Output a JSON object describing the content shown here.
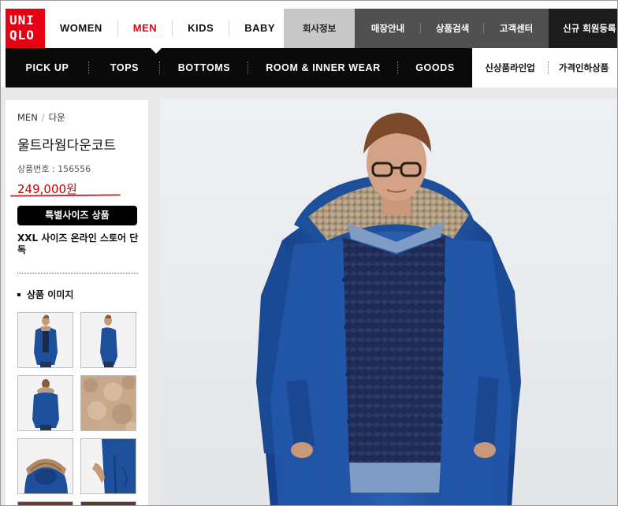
{
  "brand": {
    "logo_line1": "UNI",
    "logo_line2": "QLO",
    "red": "#e60012"
  },
  "gender_nav": [
    {
      "label": "WOMEN",
      "active": false
    },
    {
      "label": "MEN",
      "active": true
    },
    {
      "label": "KIDS",
      "active": false
    },
    {
      "label": "BABY",
      "active": false
    }
  ],
  "util_nav": {
    "company": "회사정보",
    "stores": "매장안내",
    "search": "상품검색",
    "support": "고객센터",
    "join": "신규 회원등록"
  },
  "category_nav": {
    "items": [
      "PICK UP",
      "TOPS",
      "BOTTOMS",
      "ROOM & INNER WEAR",
      "GOODS"
    ],
    "new_arrivals": "신상품라인업",
    "price_down": "가격인하상품"
  },
  "product": {
    "breadcrumb_root": "MEN",
    "breadcrumb_sep": "/",
    "breadcrumb_leaf": "다운",
    "title": "울트라웜다운코트",
    "number": "상품번호 : 156556",
    "price": "249,000원",
    "special_size_button": "특별사이즈 상품",
    "xxl_note": "XXL 사이즈 온라인 스토어 단독",
    "images_heading": "상품 이미지"
  },
  "main_image": {
    "icon": "model-photo"
  }
}
